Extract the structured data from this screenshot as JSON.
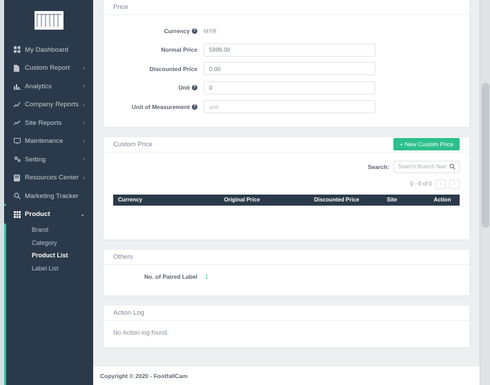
{
  "sidebar": {
    "logo_name": "footfallcam-logo",
    "items": [
      {
        "label": "My Dashboard",
        "icon": "grid-icon",
        "caret": false,
        "active": false
      },
      {
        "label": "Custom Report",
        "icon": "document-icon",
        "caret": true,
        "active": false
      },
      {
        "label": "Analytics",
        "icon": "bar-chart-icon",
        "caret": true,
        "active": false
      },
      {
        "label": "Company Reports",
        "icon": "line-chart-icon",
        "caret": true,
        "active": false
      },
      {
        "label": "Site Reports",
        "icon": "trend-chart-icon",
        "caret": true,
        "active": false
      },
      {
        "label": "Maintenance",
        "icon": "monitor-icon",
        "caret": true,
        "active": false
      },
      {
        "label": "Setting",
        "icon": "gears-icon",
        "caret": true,
        "active": false
      },
      {
        "label": "Resources Center",
        "icon": "book-icon",
        "caret": true,
        "active": false
      },
      {
        "label": "Marketing Tracker",
        "icon": "search-icon",
        "caret": false,
        "active": false
      },
      {
        "label": "Product",
        "icon": "table-icon",
        "caret": true,
        "active": true
      }
    ],
    "subitems": [
      {
        "label": "Brand",
        "current": false
      },
      {
        "label": "Category",
        "current": false
      },
      {
        "label": "Product List",
        "current": true
      },
      {
        "label": "Label List",
        "current": false
      }
    ],
    "caret_collapsed": "‹",
    "caret_expanded": "⌄",
    "accent_color": "#2ec4a0"
  },
  "price_panel": {
    "title": "Price",
    "help_glyph": "?",
    "fields": [
      {
        "label": "Currency",
        "help": true,
        "type": "static",
        "value": "MYR"
      },
      {
        "label": "Normal Price",
        "help": false,
        "type": "input",
        "value": "5999.00",
        "placeholder": ""
      },
      {
        "label": "Discounted Price",
        "help": false,
        "type": "input",
        "value": "0.00",
        "placeholder": ""
      },
      {
        "label": "Unit",
        "help": true,
        "type": "input",
        "value": "0",
        "placeholder": ""
      },
      {
        "label": "Unit of Measurement",
        "help": true,
        "type": "input",
        "value": "",
        "placeholder": "unit"
      }
    ]
  },
  "custom_price_panel": {
    "title": "Custom Price",
    "new_button_label": "+ New Custom Price",
    "search_label": "Search:",
    "search_value": "",
    "search_placeholder": "Search Branch Name",
    "search_icon": "magnifier-icon",
    "pagination_text": "0 - 0 of 0",
    "prev_label": "‹",
    "next_label": "›",
    "columns": [
      "Currency",
      "Original Price",
      "Discounted Price",
      "Site",
      "Action"
    ],
    "rows": []
  },
  "others_panel": {
    "title": "Others",
    "paired_label": "No. of Paired Label",
    "paired_value": "1"
  },
  "action_log_panel": {
    "title": "Action Log",
    "empty_text": "No Action log found."
  },
  "footer": {
    "copyright": "Copyright © 2020 - FootfallCam"
  },
  "colors": {
    "sidebar_bg": "#2b3a4a",
    "accent_green": "#2ec08c",
    "accent_teal": "#35c1a0",
    "page_bg": "#edeff1"
  }
}
